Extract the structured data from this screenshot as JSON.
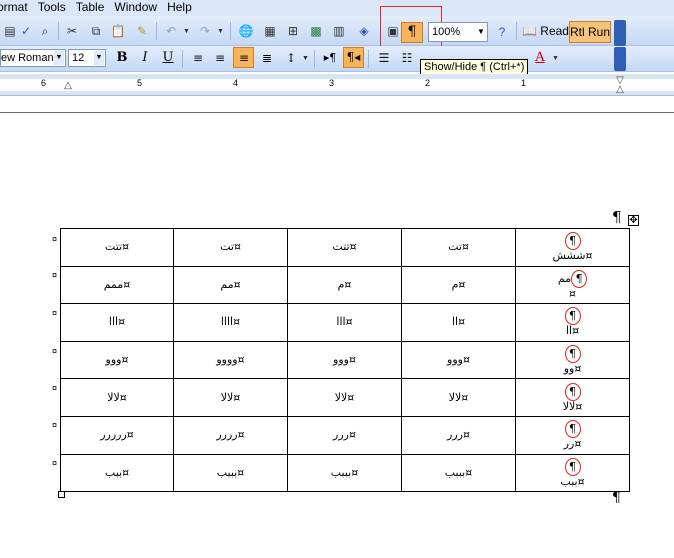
{
  "menubar": {
    "items": [
      "Format",
      "Tools",
      "Table",
      "Window",
      "Help"
    ],
    "item_format": "ormat",
    "item_tools": "Tools",
    "item_table": "Table",
    "item_window": "Window",
    "item_help": "Help"
  },
  "toolbar": {
    "zoom": "100%",
    "read_label": "Read",
    "rtl_run_label": "Rtl Run",
    "pilcrow_glyph": "¶",
    "font_name": "ew Roman",
    "font_size": "12",
    "bold": "B",
    "italic": "I",
    "underline": "U",
    "highlight_color": "#e22a2a",
    "active_button_color": "#f7b45a"
  },
  "tooltip": {
    "text": "Show/Hide ¶ (Ctrl+*)"
  },
  "ruler": {
    "numbers": [
      "6",
      "5",
      "4",
      "3",
      "2",
      "1"
    ]
  },
  "document": {
    "end_mark": "¤",
    "pilcrow": "¶",
    "rows": [
      [
        {
          "lines": [
            "تتت¤"
          ]
        },
        {
          "lines": [
            "تت¤"
          ]
        },
        {
          "lines": [
            "تتت¤"
          ]
        },
        {
          "lines": [
            "تت¤"
          ]
        },
        {
          "circle": "¶",
          "lines": [
            "ششش¤"
          ]
        }
      ],
      [
        {
          "lines": [
            "ممم¤"
          ]
        },
        {
          "lines": [
            "مم¤"
          ]
        },
        {
          "lines": [
            "م¤"
          ]
        },
        {
          "lines": [
            "م¤"
          ]
        },
        {
          "circle": "¶",
          "circle_prefix": "مم",
          "lines": [
            "¤"
          ]
        }
      ],
      [
        {
          "lines": [
            "ااا¤"
          ]
        },
        {
          "lines": [
            "اااا¤"
          ]
        },
        {
          "lines": [
            "ااا¤"
          ]
        },
        {
          "lines": [
            "اا¤"
          ]
        },
        {
          "circle": "¶",
          "lines": [
            "اا¤"
          ]
        }
      ],
      [
        {
          "lines": [
            "ووو¤"
          ]
        },
        {
          "lines": [
            "وووو¤"
          ]
        },
        {
          "lines": [
            "ووو¤"
          ]
        },
        {
          "lines": [
            "ووو¤"
          ]
        },
        {
          "circle": "¶",
          "lines": [
            "وو¤"
          ]
        }
      ],
      [
        {
          "lines": [
            "ﻻﻻ¤"
          ]
        },
        {
          "lines": [
            "ﻻﻻ¤"
          ]
        },
        {
          "lines": [
            "ﻻﻻ¤"
          ]
        },
        {
          "lines": [
            "ﻻﻻ¤"
          ]
        },
        {
          "circle": "¶",
          "lines": [
            "ﻻﻻ¤"
          ]
        }
      ],
      [
        {
          "lines": [
            "ررررر¤"
          ]
        },
        {
          "lines": [
            "رررر¤"
          ]
        },
        {
          "lines": [
            "ررر¤"
          ]
        },
        {
          "lines": [
            "ررر¤"
          ]
        },
        {
          "circle": "¶",
          "lines": [
            "رر¤"
          ]
        }
      ],
      [
        {
          "lines": [
            "ببب¤"
          ]
        },
        {
          "lines": [
            "بببب¤"
          ]
        },
        {
          "lines": [
            "بببب¤"
          ]
        },
        {
          "lines": [
            "بببب¤"
          ]
        },
        {
          "circle": "¶",
          "lines": [
            "ببب¤"
          ]
        }
      ]
    ]
  }
}
